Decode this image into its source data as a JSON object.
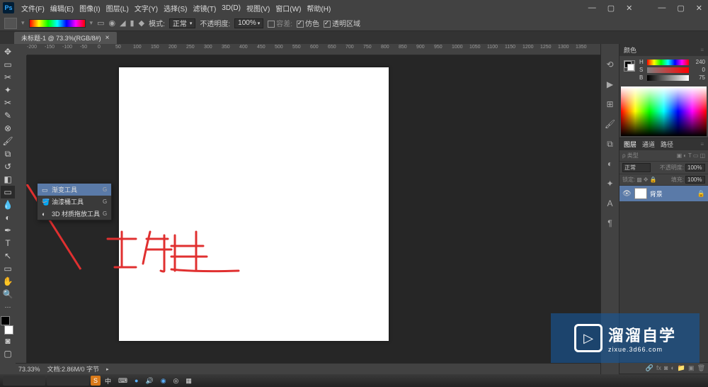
{
  "menus": [
    "文件(F)",
    "编辑(E)",
    "图像(I)",
    "图层(L)",
    "文字(Y)",
    "选择(S)",
    "滤镜(T)",
    "3D(D)",
    "视图(V)",
    "窗口(W)",
    "帮助(H)"
  ],
  "window_controls": {
    "min": "—",
    "max": "▢",
    "close": "✕",
    "sub_min": "—",
    "sub_max": "▢",
    "sub_close": "✕"
  },
  "optionsbar": {
    "mode_label": "模式:",
    "mode_value": "正常",
    "opacity_label": "不透明度:",
    "opacity_value": "100%",
    "tolerance_label": "容差:",
    "dither": "仿色",
    "transparency": "透明区域"
  },
  "tab": {
    "title": "未标题-1 @ 73.3%(RGB/8#)",
    "close": "×"
  },
  "ruler_ticks": [
    "-200",
    "-150",
    "-100",
    "-50",
    "0",
    "50",
    "100",
    "150",
    "200",
    "250",
    "300",
    "350",
    "400",
    "450",
    "500",
    "550",
    "600",
    "650",
    "700",
    "750",
    "800",
    "850",
    "900",
    "950",
    "1000",
    "1050",
    "1100",
    "1150",
    "1200",
    "1250",
    "1300",
    "1350"
  ],
  "context_menu": {
    "items": [
      {
        "icon": "▭",
        "label": "渐变工具",
        "shortcut": "G"
      },
      {
        "icon": "🪣",
        "label": "油漆桶工具",
        "shortcut": "G"
      },
      {
        "icon": "◐",
        "label": "3D 材质拖放工具",
        "shortcut": "G"
      }
    ]
  },
  "annotation_text": "右键",
  "color_panel": {
    "title": "颜色",
    "h": {
      "label": "H",
      "value": "240"
    },
    "s": {
      "label": "S",
      "value": "0"
    },
    "b": {
      "label": "B",
      "value": "75"
    }
  },
  "layers_panel": {
    "tabs": [
      "图层",
      "通道",
      "路径"
    ],
    "kind_label": "ρ 类型",
    "blend_value": "正常",
    "opacity_label": "不透明度:",
    "opacity_value": "100%",
    "lock_label": "锁定:",
    "fill_label": "填充:",
    "fill_value": "100%",
    "layer_name": "背景"
  },
  "statusbar": {
    "zoom": "73.33%",
    "info": "文档:2.86M/0 字节"
  },
  "taskbar": {
    "ime": "S",
    "ime2": "中",
    "kb": "⌨",
    "sound": "🔊",
    "items": [
      "◉",
      "◎",
      "◉",
      "◉"
    ]
  },
  "watermark": {
    "big": "溜溜自学",
    "small": "zixue.3d66.com"
  }
}
